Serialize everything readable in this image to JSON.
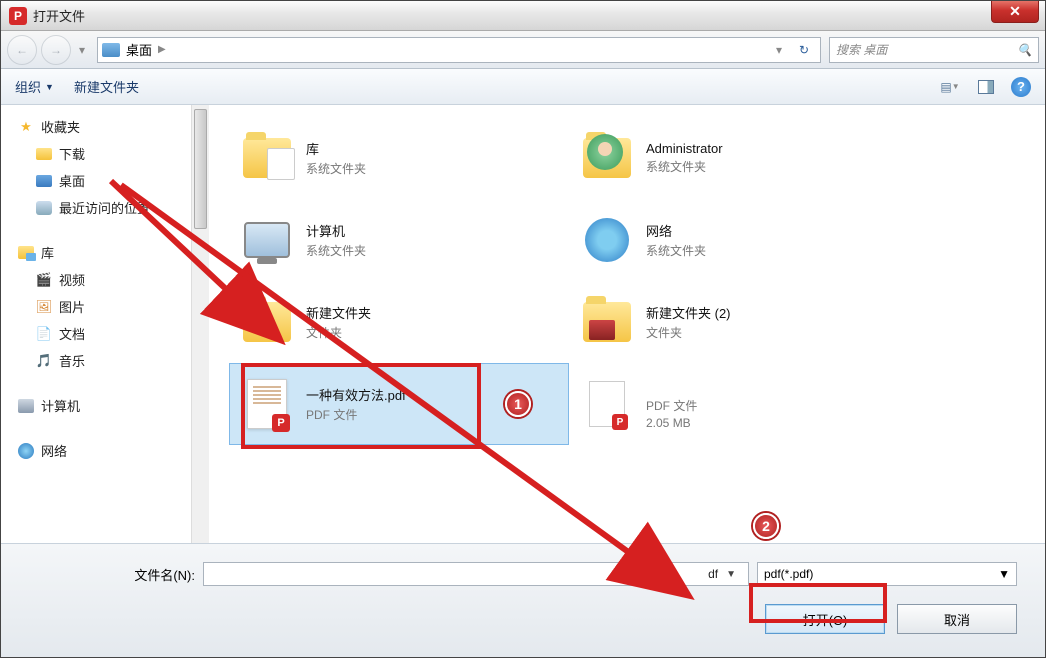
{
  "window": {
    "title": "打开文件"
  },
  "nav": {
    "location": "桌面",
    "search_placeholder": "搜索 桌面"
  },
  "toolbar": {
    "organize": "组织",
    "new_folder": "新建文件夹"
  },
  "sidebar": {
    "favorites": {
      "title": "收藏夹",
      "items": [
        "下载",
        "桌面",
        "最近访问的位置"
      ]
    },
    "libraries": {
      "title": "库",
      "items": [
        "视频",
        "图片",
        "文档",
        "音乐"
      ]
    },
    "computer": "计算机",
    "network": "网络"
  },
  "content": {
    "items": [
      {
        "name": "库",
        "sub": "系统文件夹"
      },
      {
        "name": "Administrator",
        "sub": "系统文件夹"
      },
      {
        "name": "计算机",
        "sub": "系统文件夹"
      },
      {
        "name": "网络",
        "sub": "系统文件夹"
      },
      {
        "name": "新建文件夹",
        "sub": "文件夹"
      },
      {
        "name": "新建文件夹 (2)",
        "sub": "文件夹"
      },
      {
        "name": "一种有效方法.pdf",
        "sub": "PDF 文件"
      },
      {
        "name": "",
        "sub": "PDF 文件",
        "sub2": "2.05 MB"
      }
    ]
  },
  "footer": {
    "filename_label": "文件名(N):",
    "filename_value": "",
    "filename_display_suffix": "df",
    "filter": "pdf(*.pdf)",
    "open": "打开(O)",
    "cancel": "取消"
  },
  "annotations": {
    "badge1": "1",
    "badge2": "2"
  }
}
